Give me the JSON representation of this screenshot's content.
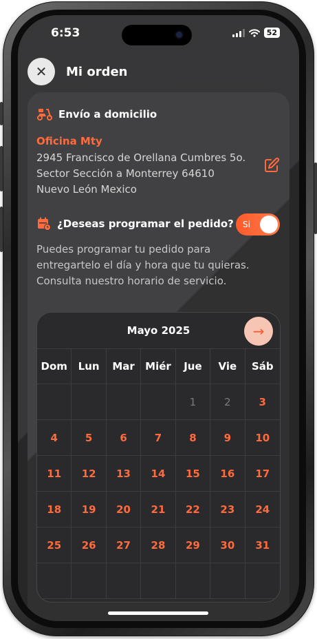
{
  "status": {
    "time": "6:53",
    "battery": "52"
  },
  "header": {
    "title": "Mi orden",
    "close_symbol": "✕"
  },
  "delivery": {
    "label": "Envío a domicilio",
    "address_name": "Oficina Mty",
    "address_lines": [
      "2945 Francisco de Orellana Cumbres 5o.",
      "Sector Sección a Monterrey 64610",
      "Nuevo León Mexico"
    ]
  },
  "schedule": {
    "question": "¿Deseas programar el pedido?",
    "toggle_label": "Si",
    "toggle_on": true,
    "description": "Puedes programar tu pedido para entregartelo el día y hora que tu quieras. Consulta nuestro horario de servicio."
  },
  "calendar": {
    "month": "Mayo 2025",
    "next_symbol": "→",
    "weekdays": [
      "Dom",
      "Lun",
      "Mar",
      "Miér",
      "Jue",
      "Vie",
      "Sáb"
    ],
    "weeks": [
      [
        "",
        "",
        "",
        "",
        "1",
        "2",
        "3"
      ],
      [
        "4",
        "5",
        "6",
        "7",
        "8",
        "9",
        "10"
      ],
      [
        "11",
        "12",
        "13",
        "14",
        "15",
        "16",
        "17"
      ],
      [
        "18",
        "19",
        "20",
        "21",
        "22",
        "23",
        "24"
      ],
      [
        "25",
        "26",
        "27",
        "28",
        "29",
        "30",
        "31"
      ],
      [
        "",
        "",
        "",
        "",
        "",
        "",
        ""
      ]
    ],
    "disabled_days": [
      "1",
      "2"
    ]
  },
  "colors": {
    "accent": "#ff6b3d",
    "background": "#2c2c2e",
    "card": "#3a3a3c"
  },
  "icons": [
    "close-icon",
    "scooter-icon",
    "edit-icon",
    "calendar-clock-icon",
    "arrow-right-icon"
  ]
}
